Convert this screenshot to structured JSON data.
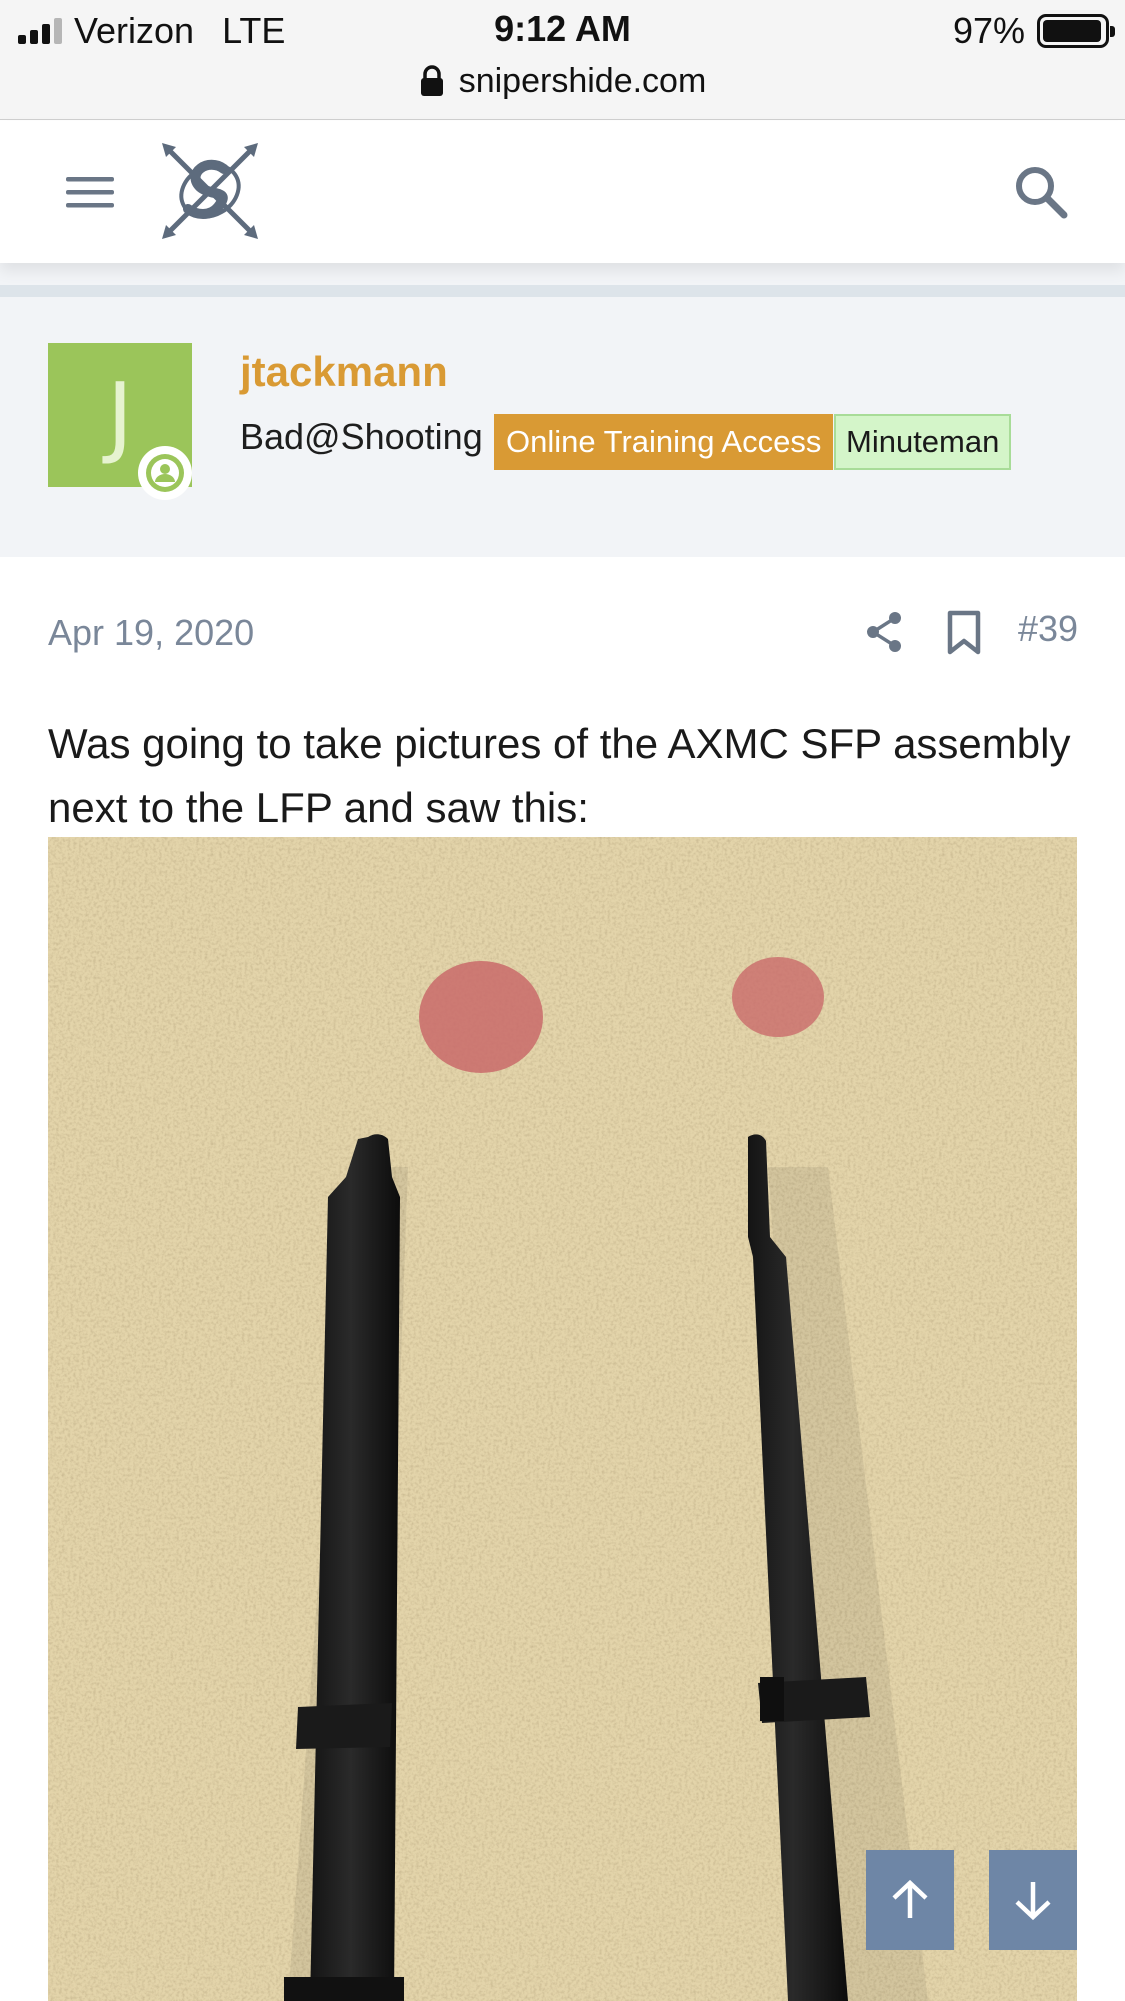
{
  "status_bar": {
    "carrier": "Verizon",
    "network": "LTE",
    "time": "9:12 AM",
    "battery_percent": "97%",
    "battery_level": 0.97
  },
  "browser": {
    "url": "snipershide.com"
  },
  "site_header": {
    "menu_icon": "hamburger-menu-icon",
    "logo_icon": "snipers-hide-logo-icon",
    "search_icon": "search-icon"
  },
  "post_author": {
    "avatar_letter": "J",
    "avatar_color": "#9bc55a",
    "username": "jtackmann",
    "user_title": "Bad@Shooting",
    "badges": [
      {
        "label": "Online Training Access",
        "color": "#d99a34"
      },
      {
        "label": "Minuteman",
        "color": "#d4f5c9"
      }
    ]
  },
  "post": {
    "date": "Apr 19, 2020",
    "number": "#39",
    "text": "Was going to take pictures of the AXMC SFP assembly next to the LFP and saw this:",
    "share_icon": "share-icon",
    "bookmark_icon": "bookmark-icon"
  },
  "scroll_controls": {
    "up_icon": "arrow-up-icon",
    "down_icon": "arrow-down-icon",
    "color": "#6e86a6"
  },
  "colors": {
    "accent": "#d99a34",
    "muted_text": "#7a8799",
    "band": "#f2f4f7"
  }
}
